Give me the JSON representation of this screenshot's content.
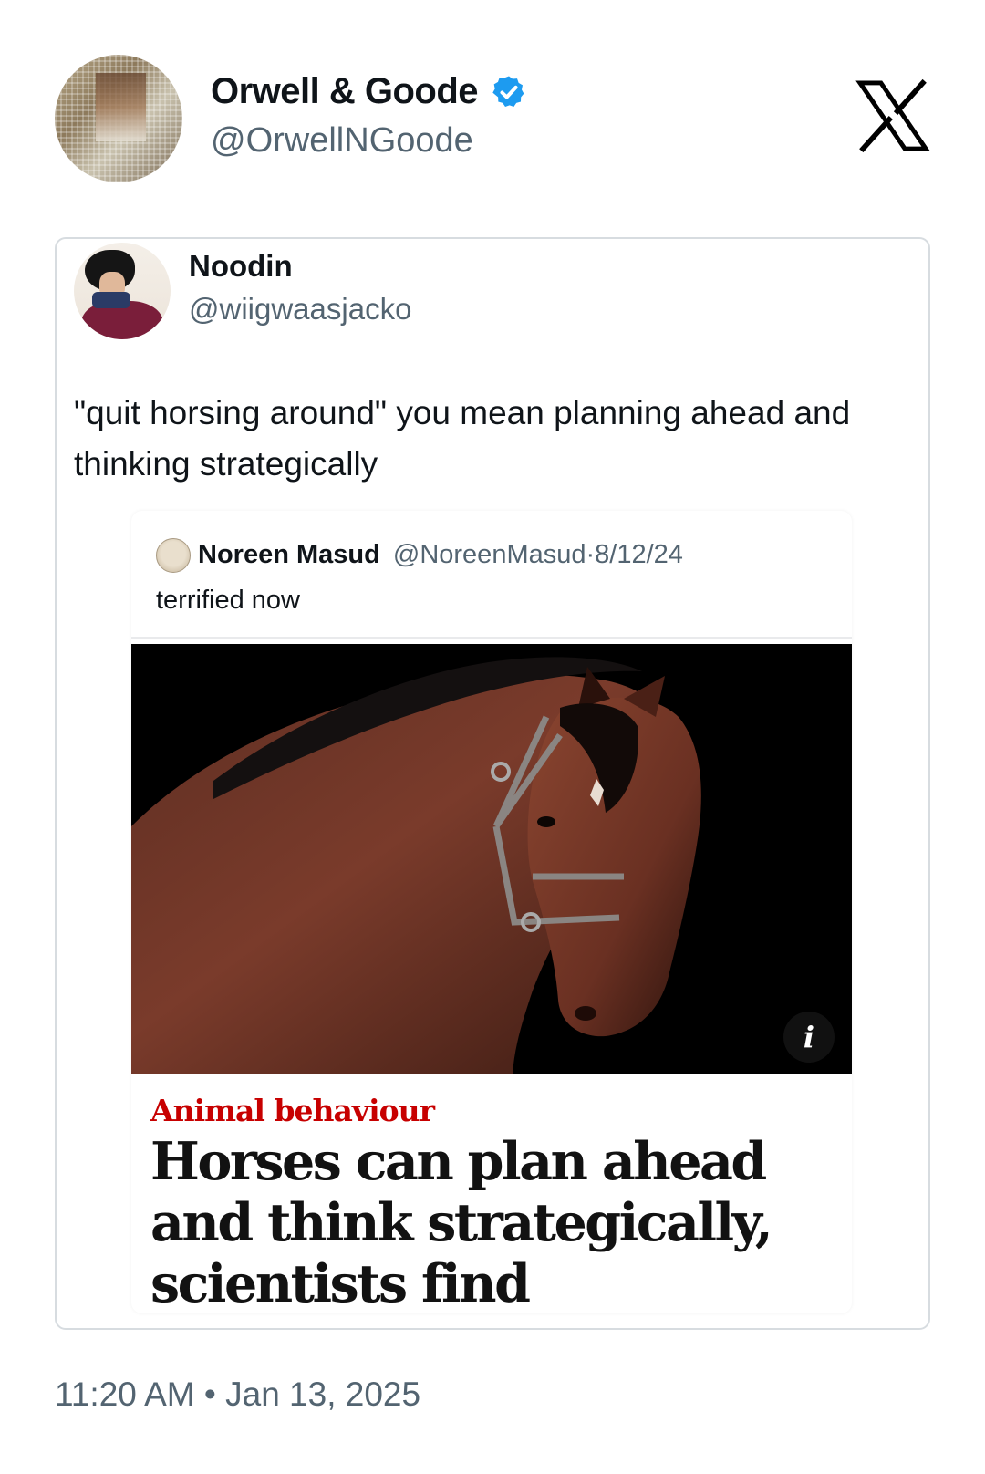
{
  "post": {
    "author": {
      "name": "Orwell & Goode",
      "handle": "@OrwellNGoode",
      "verified": true,
      "verified_color": "#1d9bf0"
    },
    "platform_logo": "x-logo-icon",
    "timestamp": {
      "time": "11:20 AM",
      "separator": "•",
      "date": "Jan 13, 2025"
    }
  },
  "quoted_post": {
    "author": {
      "name": "Noodin",
      "handle": "@wiigwaasjacko"
    },
    "text": "\"quit horsing around\" you mean planning ahead and thinking strategically",
    "embedded_screenshot": {
      "author_name": "Noreen Masud",
      "author_handle": "@NoreenMasud",
      "separator": "·",
      "date": "8/12/24",
      "text": "terrified now",
      "info_button": "i",
      "article": {
        "category": "Animal behaviour",
        "category_color": "#c70000",
        "headline": "Horses can plan ahead and think strategically, scientists find"
      }
    }
  },
  "colors": {
    "text_primary": "#0f1419",
    "text_secondary": "#536471",
    "border": "#d7dce0"
  }
}
